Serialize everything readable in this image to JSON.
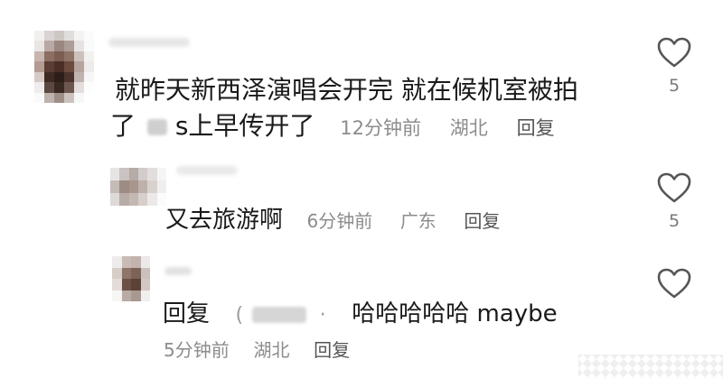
{
  "comments": [
    {
      "line1": "就昨天新西泽演唱会开完 就在候机室被拍",
      "line2_pre": "了",
      "line2_post": "s上早传开了",
      "time": "12分钟前",
      "location": "湖北",
      "reply_label": "回复",
      "like_count": "5",
      "icon": "heart-outline"
    },
    {
      "text": "又去旅游啊",
      "time": "6分钟前",
      "location": "广东",
      "reply_label": "回复",
      "like_count": "5",
      "icon": "heart-outline"
    },
    {
      "prefix": "回复",
      "mention_open": "(",
      "mention_sep": "·",
      "text": "哈哈哈哈哈 maybe",
      "time": "5分钟前",
      "location": "湖北",
      "reply_label": "回复",
      "icon": "heart-outline"
    }
  ],
  "colors": {
    "text": "#1a1a1a",
    "meta": "#8c8c8c",
    "icon": "#555555"
  }
}
